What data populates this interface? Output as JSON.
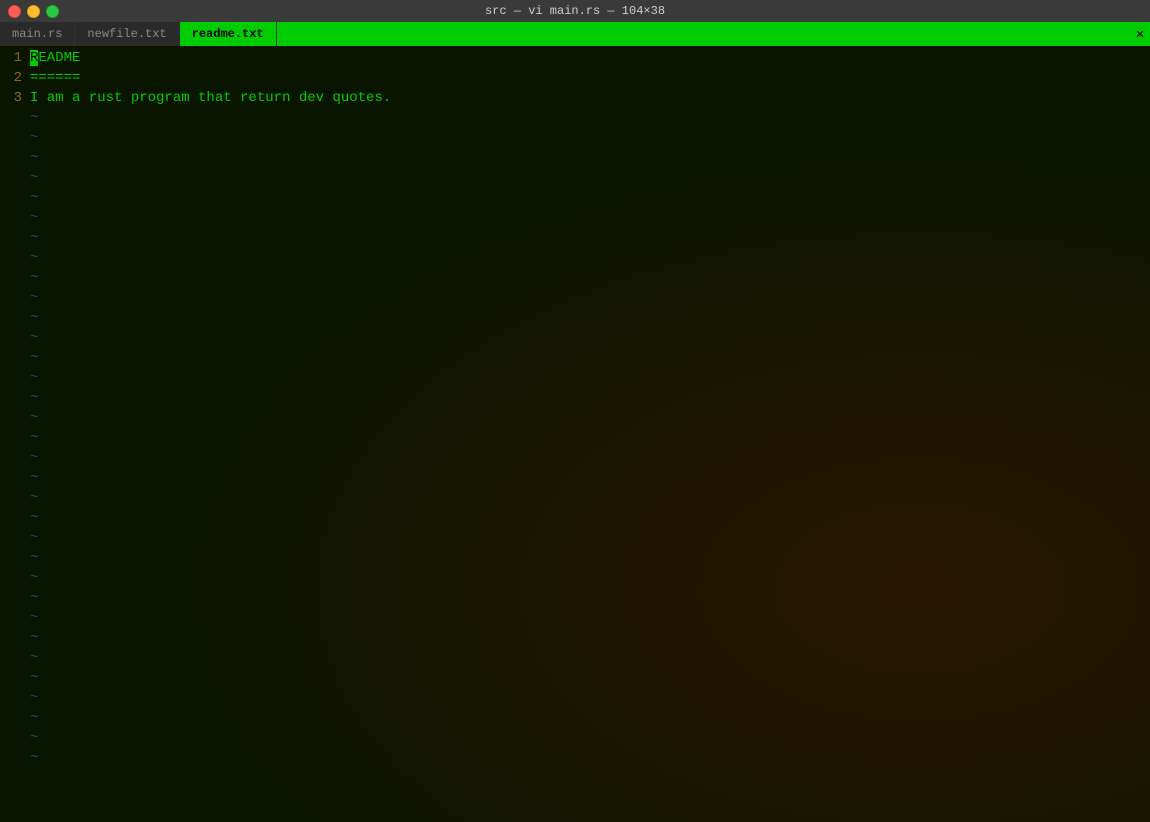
{
  "titleBar": {
    "title": "src — vi main.rs — 104×38"
  },
  "tabs": [
    {
      "id": "main-rs",
      "label": "main.rs",
      "active": false
    },
    {
      "id": "newfile-txt",
      "label": "newfile.txt",
      "active": false
    },
    {
      "id": "readme-txt",
      "label": "readme.txt",
      "active": true
    }
  ],
  "closeButton": "✕",
  "editor": {
    "lines": [
      {
        "number": "1",
        "content": "README",
        "cursorOnFirst": true
      },
      {
        "number": "2",
        "content": "======"
      },
      {
        "number": "3",
        "content": "I am a rust program that return dev quotes."
      }
    ],
    "tildes": 33
  }
}
